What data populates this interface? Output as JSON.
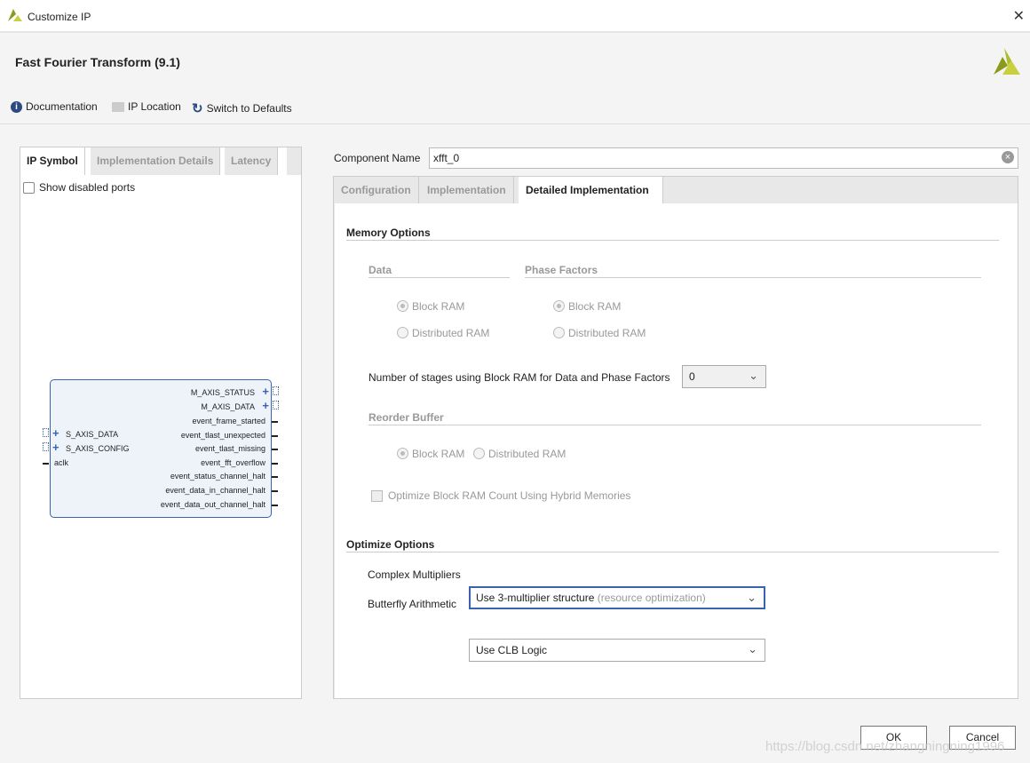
{
  "window": {
    "title": "Customize IP",
    "close": "✕"
  },
  "header": {
    "title": "Fast Fourier Transform (9.1)"
  },
  "toolbar": {
    "documentation": "Documentation",
    "ip_location": "IP Location",
    "switch_defaults": "Switch to Defaults"
  },
  "left": {
    "tabs": [
      "IP Symbol",
      "Implementation Details",
      "Latency"
    ],
    "show_disabled": "Show disabled ports",
    "ports_right": [
      "M_AXIS_STATUS",
      "M_AXIS_DATA",
      "event_frame_started",
      "event_tlast_unexpected",
      "event_tlast_missing",
      "event_fft_overflow",
      "event_status_channel_halt",
      "event_data_in_channel_halt",
      "event_data_out_channel_halt"
    ],
    "ports_left": [
      "S_AXIS_DATA",
      "S_AXIS_CONFIG",
      "aclk"
    ]
  },
  "component": {
    "label": "Component Name",
    "value": "xfft_0"
  },
  "tabs": [
    "Configuration",
    "Implementation",
    "Detailed Implementation"
  ],
  "memory": {
    "title": "Memory Options",
    "data": "Data",
    "phase": "Phase Factors",
    "block_ram": "Block RAM",
    "dist_ram": "Distributed RAM",
    "stages_label": "Number of stages using Block RAM for Data and Phase Factors",
    "stages_value": "0",
    "reorder": "Reorder Buffer",
    "hybrid": "Optimize Block RAM Count Using Hybrid Memories"
  },
  "optimize": {
    "title": "Optimize Options",
    "cm_label": "Complex Multipliers",
    "cm_value": "Use 3-multiplier structure",
    "cm_hint": "(resource optimization)",
    "ba_label": "Butterfly Arithmetic",
    "ba_value": "Use CLB Logic"
  },
  "buttons": {
    "ok": "OK",
    "cancel": "Cancel"
  },
  "watermark": "https://blog.csdn.net/zhangningning1996"
}
